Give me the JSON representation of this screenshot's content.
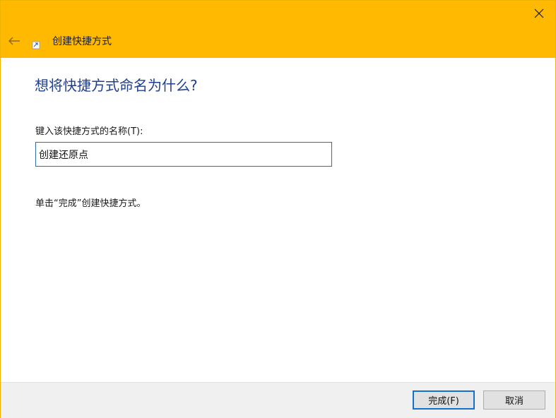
{
  "wizard": {
    "title": "创建快捷方式",
    "heading": "想将快捷方式命名为什么?",
    "name_label": "键入该快捷方式的名称(T):",
    "name_value": "创建还原点",
    "hint": "单击“完成”创建快捷方式。"
  },
  "buttons": {
    "finish_label": "完成(F)",
    "cancel_label": "取消"
  },
  "icons": {
    "back": "back-arrow-icon",
    "close": "close-icon",
    "app": "shortcut-icon"
  },
  "colors": {
    "titlebar": "#ffb900",
    "heading": "#1f3f8f",
    "input_border": "#2f6ea5",
    "default_button_border": "#1470c8"
  }
}
